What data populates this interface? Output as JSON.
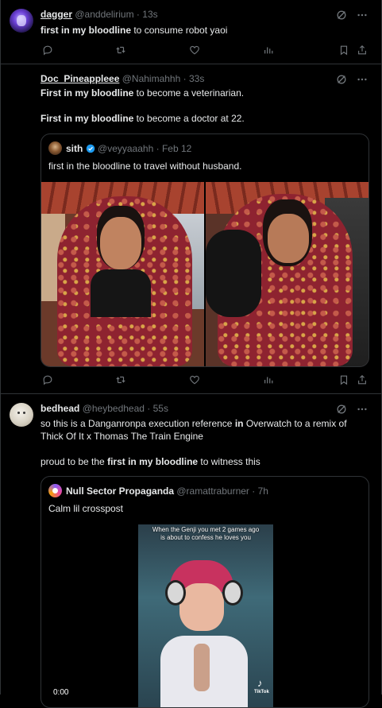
{
  "tweets": [
    {
      "name": "dagger",
      "handle": "@anddelirium",
      "time": "13s",
      "text_bold": "first in my bloodline",
      "text_rest": " to consume robot yaoi"
    },
    {
      "name": "Doc_Pineappleee",
      "handle": "@Nahimahhh",
      "time": "33s",
      "line1_bold": "First in my bloodline",
      "line1_rest": " to become a veterinarian.",
      "line2_bold": "First in my bloodline",
      "line2_rest": " to become a doctor at 22.",
      "quote": {
        "name": "sith",
        "handle": "@veyyaaahh",
        "time": "Feb 12",
        "text": "first in the bloodline to travel without husband."
      }
    },
    {
      "name": "bedhead",
      "handle": "@heybedhead",
      "time": "55s",
      "line1_pre": "so this is a Danganronpa execution reference ",
      "line1_bold": "in",
      "line1_post": " Overwatch to a remix of",
      "line2": "Thick Of It x Thomas The Train Engine",
      "line3_pre": "proud to be the ",
      "line3_bold": "first in my bloodline",
      "line3_post": " to witness this",
      "quote": {
        "name": "Null Sector Propaganda",
        "handle": "@ramattraburner",
        "time": "7h",
        "text": "Calm lil crosspost",
        "video_caption": "When the Genji you met 2 games ago\nis about to confess he loves you",
        "video_badge": "TikTok",
        "video_time": "0:00"
      }
    }
  ],
  "meta": {
    "dot": "·"
  },
  "icons": [
    "grok-icon",
    "more-icon",
    "reply-icon",
    "retweet-icon",
    "like-icon",
    "views-icon",
    "bookmark-icon",
    "share-icon",
    "verified-icon"
  ]
}
